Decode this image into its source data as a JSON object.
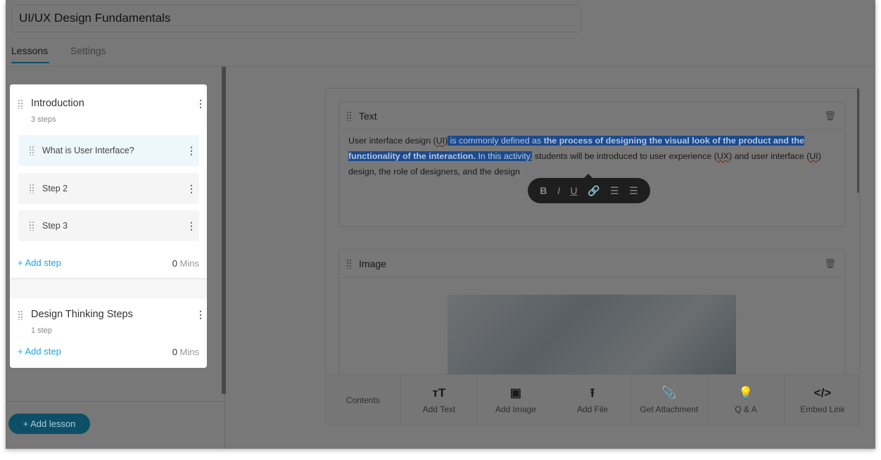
{
  "course_title": "UI/UX Design Fundamentals",
  "tabs": [
    {
      "label": "Lessons",
      "active": true
    },
    {
      "label": "Settings",
      "active": false
    }
  ],
  "lessons": [
    {
      "title": "Introduction",
      "steps_count": "3 steps",
      "steps": [
        {
          "label": "What is User Interface?",
          "active": true
        },
        {
          "label": "Step 2"
        },
        {
          "label": "Step 3"
        }
      ],
      "add_step": "+ Add step",
      "mins_value": "0",
      "mins_unit": "Mins"
    },
    {
      "title": "Design Thinking Steps",
      "steps_count": "1 step",
      "add_step": "+ Add step",
      "mins_value": "0",
      "mins_unit": "Mins"
    }
  ],
  "add_lesson": "+ Add lesson",
  "editor": {
    "text_block": {
      "title": "Text",
      "p1": "User interface design (",
      "ui1": "UI",
      "p2": ")",
      "sel1": " is commonly defined as ",
      "sel2": "the process of designing the visual look of the product and the functionality of the interaction.",
      "sel3": " In this activity,",
      "p3": " students will be introduced to user experience (",
      "ux": "UX",
      "p4": ") and user interface (",
      "ui2": "UI",
      "p5": ") design, the role of designers, and the design"
    },
    "format_bar": [
      "B",
      "I",
      "U",
      "link",
      "ordered-list",
      "bullet-list"
    ],
    "image_block": {
      "title": "Image"
    },
    "toolbar": {
      "contents": "Contents",
      "items": [
        {
          "label": "Add Text",
          "icon": "text-size-icon"
        },
        {
          "label": "Add Image",
          "icon": "image-icon"
        },
        {
          "label": "Add File",
          "icon": "upload-icon"
        },
        {
          "label": "Get Attachment",
          "icon": "paperclip-icon"
        },
        {
          "label": "Q & A",
          "icon": "lightbulb-icon"
        },
        {
          "label": "Embed Link",
          "icon": "code-icon"
        }
      ]
    }
  },
  "colors": {
    "accent": "#1a9fd0",
    "link": "#1aa7de",
    "selection": "#2f6fd8"
  }
}
